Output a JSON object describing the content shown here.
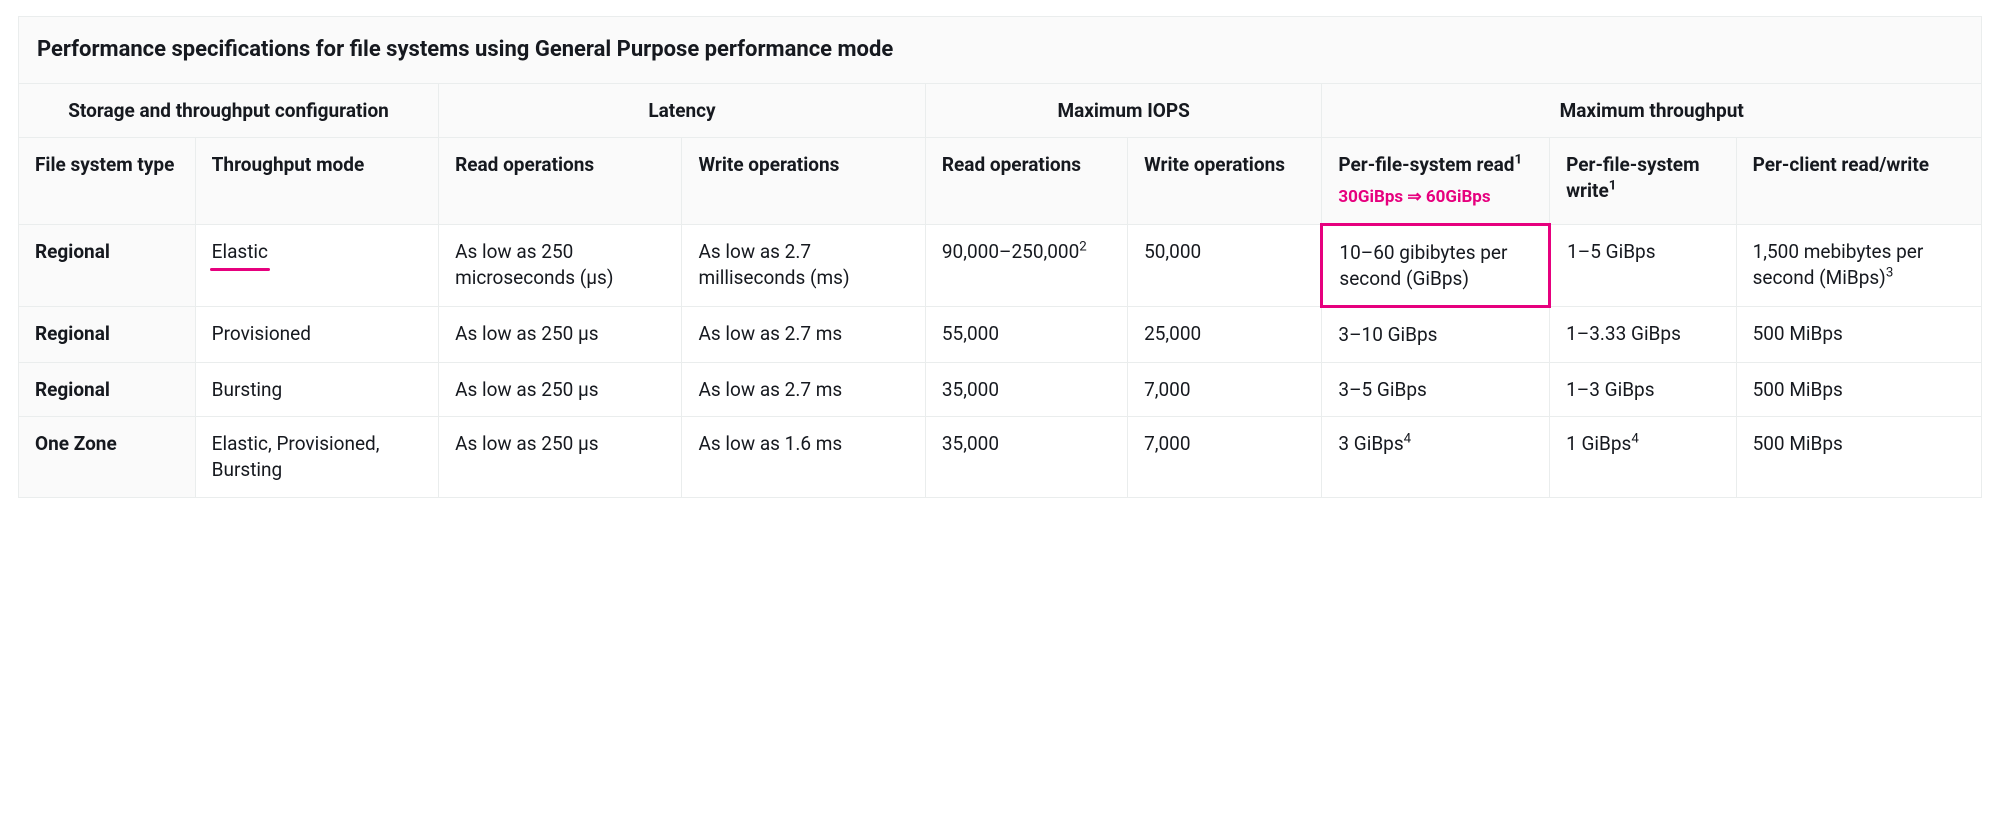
{
  "title": "Performance specifications for file systems using General Purpose performance mode",
  "header_groups": {
    "storage_cfg": "Storage and throughput configuration",
    "latency": "Latency",
    "max_iops": "Maximum IOPS",
    "max_throughput": "Maximum throughput"
  },
  "headers": {
    "fs_type": "File system type",
    "throughput_mode": "Throughput mode",
    "lat_read": "Read operations",
    "lat_write": "Write operations",
    "iops_read": "Read operations",
    "iops_write": "Write operations",
    "th_read": "Per-file-system read",
    "th_read_sup": "1",
    "th_write": "Per-file-system write",
    "th_write_sup": "1",
    "th_client": "Per-client read/write"
  },
  "annotation": {
    "before": "30GiBps",
    "arrow": "⇒",
    "after": "60GiBps"
  },
  "rows": [
    {
      "fs_type": "Regional",
      "mode": "Elastic",
      "lat_read": "As low as 250 microseconds (μs)",
      "lat_write": "As low as 2.7 milliseconds (ms)",
      "iops_read": "90,000–250,000",
      "iops_read_sup": "2",
      "iops_write": "50,000",
      "th_read": "10–60 gibibytes per second (GiBps)",
      "th_read_sup": "",
      "th_write": "1–5 GiBps",
      "th_write_sup": "",
      "th_client": "1,500 mebibytes per second (MiBps)",
      "th_client_sup": "3",
      "mode_underline": true,
      "th_read_box": true
    },
    {
      "fs_type": "Regional",
      "mode": "Provisioned",
      "lat_read": "As low as 250 μs",
      "lat_write": "As low as 2.7 ms",
      "iops_read": "55,000",
      "iops_read_sup": "",
      "iops_write": "25,000",
      "th_read": "3–10 GiBps",
      "th_read_sup": "",
      "th_write": "1–3.33 GiBps",
      "th_write_sup": "",
      "th_client": "500 MiBps",
      "th_client_sup": ""
    },
    {
      "fs_type": "Regional",
      "mode": "Bursting",
      "lat_read": "As low as 250 μs",
      "lat_write": "As low as 2.7 ms",
      "iops_read": "35,000",
      "iops_read_sup": "",
      "iops_write": "7,000",
      "th_read": "3–5 GiBps",
      "th_read_sup": "",
      "th_write": "1–3 GiBps",
      "th_write_sup": "",
      "th_client": "500 MiBps",
      "th_client_sup": ""
    },
    {
      "fs_type": "One Zone",
      "mode": "Elastic, Provisioned, Bursting",
      "lat_read": "As low as 250 μs",
      "lat_write": "As low as 1.6 ms",
      "iops_read": "35,000",
      "iops_read_sup": "",
      "iops_write": "7,000",
      "th_read": "3 GiBps",
      "th_read_sup": "4",
      "th_write": "1 GiBps",
      "th_write_sup": "4",
      "th_client": "500 MiBps",
      "th_client_sup": ""
    }
  ]
}
